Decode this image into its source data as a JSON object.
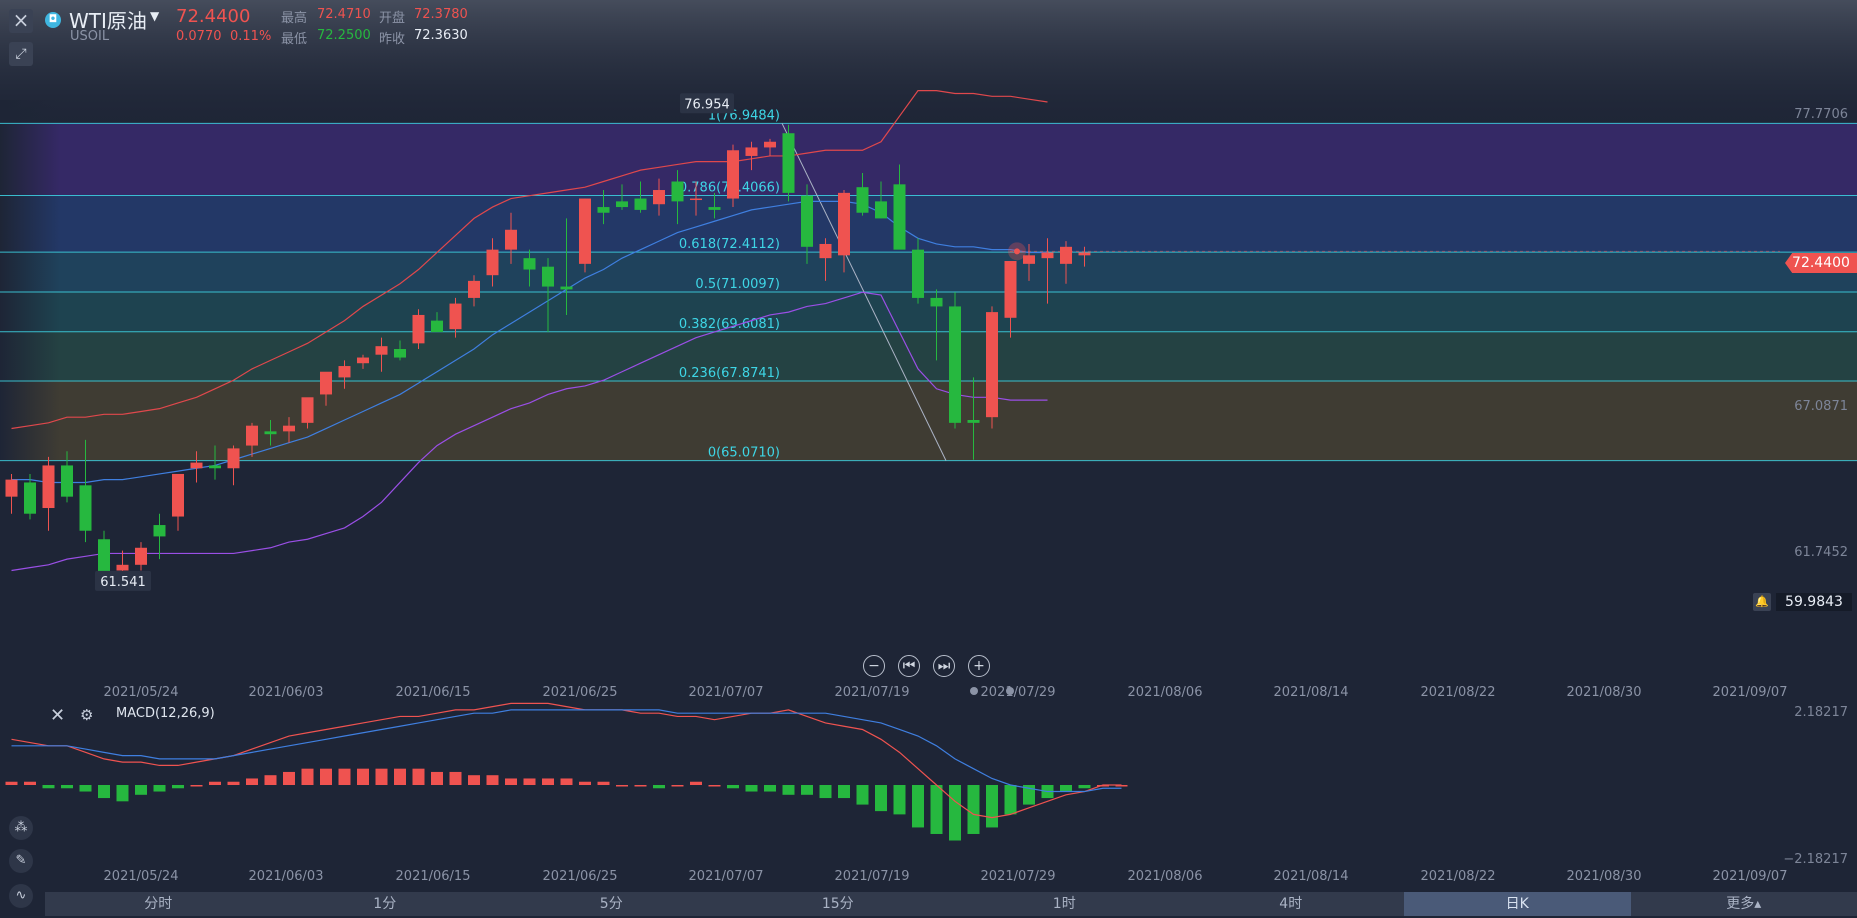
{
  "header": {
    "symbol_name": "WTI原油",
    "symbol_code": "USOIL",
    "price": "72.4400",
    "change": "0.0770",
    "change_pct": "0.11%",
    "high_label": "最高",
    "high": "72.4710",
    "open_label": "开盘",
    "open": "72.3780",
    "low_label": "最低",
    "low": "72.2500",
    "prev_label": "昨收",
    "prev_close": "72.3630"
  },
  "colors": {
    "up": "#ef5350",
    "down": "#26b83f",
    "fib": "#3ed6e6",
    "bb_upper": "#e0484c",
    "bb_mid": "#3f7fe0",
    "bb_lower": "#9a4fe6",
    "background": "#1e2536"
  },
  "price_axis": [
    "77.7706",
    "67.0871",
    "61.7452"
  ],
  "current_price_tag": "72.4400",
  "alert_price": "59.9843",
  "extremes": {
    "high": "76.954",
    "low": "61.541"
  },
  "nav_buttons": [
    "−",
    "⏮",
    "⏭",
    "+"
  ],
  "macd": {
    "title": "MACD(12,26,9)",
    "axis_top": "2.18217",
    "axis_bottom": "−2.18217"
  },
  "tabs": [
    "分时",
    "1分",
    "5分",
    "15分",
    "1时",
    "4时",
    "日K",
    "更多▴"
  ],
  "active_tab": 6,
  "chart_data": {
    "type": "candlestick",
    "dates": [
      "2021/05/24",
      "2021/06/03",
      "2021/06/15",
      "2021/06/25",
      "2021/07/07",
      "2021/07/19",
      "2021/07/29",
      "2021/08/06",
      "2021/08/14",
      "2021/08/22",
      "2021/08/30",
      "2021/09/07"
    ],
    "candles": [
      [
        63.8,
        64.6,
        63.2,
        64.4
      ],
      [
        64.3,
        64.6,
        63.0,
        63.2
      ],
      [
        63.4,
        65.2,
        62.6,
        64.9
      ],
      [
        64.9,
        65.4,
        63.6,
        63.8
      ],
      [
        64.2,
        65.8,
        62.2,
        62.6
      ],
      [
        62.3,
        62.6,
        60.5,
        61.1
      ],
      [
        61.2,
        61.9,
        61.0,
        61.4
      ],
      [
        61.4,
        62.2,
        61.2,
        62.0
      ],
      [
        62.8,
        63.2,
        61.6,
        62.4
      ],
      [
        63.1,
        63.6,
        62.6,
        64.6
      ],
      [
        64.8,
        65.4,
        64.3,
        65.0
      ],
      [
        64.9,
        65.6,
        64.4,
        64.8
      ],
      [
        64.8,
        65.6,
        64.2,
        65.5
      ],
      [
        65.6,
        66.4,
        65.2,
        66.3
      ],
      [
        66.1,
        66.5,
        65.6,
        66.0
      ],
      [
        66.1,
        66.6,
        65.7,
        66.3
      ],
      [
        66.4,
        67.2,
        66.2,
        67.3
      ],
      [
        67.4,
        67.8,
        67.0,
        68.2
      ],
      [
        68.0,
        68.6,
        67.6,
        68.4
      ],
      [
        68.5,
        68.8,
        68.3,
        68.7
      ],
      [
        68.8,
        69.4,
        68.2,
        69.1
      ],
      [
        69.0,
        69.3,
        68.6,
        68.7
      ],
      [
        69.2,
        70.4,
        69.0,
        70.2
      ],
      [
        70.0,
        70.3,
        69.7,
        69.6
      ],
      [
        69.7,
        70.8,
        69.4,
        70.6
      ],
      [
        70.8,
        71.6,
        70.5,
        71.4
      ],
      [
        71.6,
        72.9,
        71.2,
        72.5
      ],
      [
        72.5,
        73.8,
        72.0,
        73.2
      ],
      [
        72.2,
        72.5,
        71.2,
        71.8
      ],
      [
        71.9,
        72.2,
        69.6,
        71.2
      ],
      [
        71.2,
        73.6,
        70.2,
        71.1
      ],
      [
        72.0,
        74.3,
        71.7,
        74.3
      ],
      [
        74.0,
        74.6,
        73.4,
        73.8
      ],
      [
        74.2,
        74.8,
        73.9,
        74.0
      ],
      [
        74.3,
        74.9,
        73.8,
        73.9
      ],
      [
        74.1,
        75.0,
        73.7,
        74.6
      ],
      [
        74.9,
        75.3,
        73.4,
        74.2
      ],
      [
        74.3,
        74.9,
        73.7,
        74.3
      ],
      [
        74.0,
        74.5,
        73.6,
        73.9
      ],
      [
        74.3,
        76.2,
        74.0,
        76.0
      ],
      [
        75.8,
        76.3,
        75.3,
        76.1
      ],
      [
        76.1,
        76.4,
        75.8,
        76.3
      ],
      [
        76.6,
        76.9,
        74.2,
        74.5
      ],
      [
        74.4,
        74.8,
        72.0,
        72.6
      ],
      [
        72.2,
        72.9,
        71.4,
        72.7
      ],
      [
        72.3,
        74.6,
        71.7,
        74.5
      ],
      [
        74.7,
        75.2,
        73.7,
        73.8
      ],
      [
        74.2,
        74.9,
        73.6,
        73.6
      ],
      [
        74.8,
        75.5,
        72.7,
        72.5
      ],
      [
        72.5,
        72.9,
        70.6,
        70.8
      ],
      [
        70.8,
        71.1,
        68.6,
        70.5
      ],
      [
        70.5,
        71.0,
        66.2,
        66.4
      ],
      [
        66.5,
        68.0,
        65.1,
        66.4
      ],
      [
        66.6,
        70.5,
        66.2,
        70.3
      ],
      [
        70.1,
        72.0,
        69.4,
        72.1
      ],
      [
        72.0,
        72.7,
        71.4,
        72.3
      ],
      [
        72.2,
        72.9,
        70.6,
        72.4
      ],
      [
        72.0,
        72.8,
        71.3,
        72.6
      ],
      [
        72.3,
        72.6,
        71.9,
        72.4
      ]
    ],
    "fib": {
      "labels": [
        "1(76.9484)",
        "0.786(74.4066)",
        "0.618(72.4112)",
        "0.5(71.0097)",
        "0.382(69.6081)",
        "0.236(67.8741)",
        "0(65.0710)"
      ],
      "levels": [
        76.9484,
        74.4066,
        72.4112,
        71.0097,
        69.6081,
        67.8741,
        65.071
      ]
    },
    "bollinger": {
      "upper": [
        66.2,
        66.3,
        66.4,
        66.6,
        66.6,
        66.7,
        66.7,
        66.8,
        66.9,
        67.1,
        67.3,
        67.6,
        67.9,
        68.3,
        68.6,
        68.9,
        69.2,
        69.6,
        70.0,
        70.5,
        70.9,
        71.3,
        71.8,
        72.4,
        73.0,
        73.6,
        74.0,
        74.3,
        74.4,
        74.5,
        74.6,
        74.7,
        74.9,
        75.1,
        75.3,
        75.4,
        75.5,
        75.6,
        75.6,
        75.6,
        75.7,
        75.8,
        75.8,
        75.9,
        76.0,
        76.0,
        76.0,
        76.3,
        77.2,
        78.1,
        78.1,
        78.0,
        78.0,
        77.9,
        77.9,
        77.8,
        77.7
      ],
      "mid": [
        64.4,
        64.4,
        64.3,
        64.3,
        64.3,
        64.4,
        64.4,
        64.5,
        64.6,
        64.7,
        64.8,
        64.9,
        65.1,
        65.3,
        65.5,
        65.7,
        65.9,
        66.2,
        66.5,
        66.8,
        67.1,
        67.4,
        67.8,
        68.2,
        68.6,
        69.0,
        69.5,
        69.9,
        70.3,
        70.7,
        71.1,
        71.5,
        71.8,
        72.2,
        72.5,
        72.8,
        73.1,
        73.3,
        73.5,
        73.7,
        73.9,
        74.0,
        74.1,
        74.2,
        74.2,
        74.2,
        74.1,
        73.8,
        73.3,
        72.9,
        72.7,
        72.6,
        72.6,
        72.5,
        72.5,
        72.4,
        72.4
      ],
      "lower": [
        61.2,
        61.3,
        61.4,
        61.6,
        61.7,
        61.8,
        61.8,
        61.8,
        61.8,
        61.8,
        61.8,
        61.8,
        61.8,
        61.9,
        62.0,
        62.2,
        62.3,
        62.5,
        62.7,
        63.1,
        63.6,
        64.3,
        65.0,
        65.6,
        66.0,
        66.3,
        66.6,
        66.9,
        67.1,
        67.4,
        67.6,
        67.7,
        67.9,
        68.2,
        68.5,
        68.8,
        69.1,
        69.4,
        69.6,
        69.8,
        70.0,
        70.2,
        70.3,
        70.5,
        70.6,
        70.8,
        71.0,
        70.9,
        69.6,
        68.3,
        67.6,
        67.4,
        67.3,
        67.3,
        67.2,
        67.2,
        67.2
      ]
    },
    "macd": {
      "dif": [
        1.4,
        1.3,
        1.2,
        1.2,
        1.0,
        0.8,
        0.7,
        0.7,
        0.6,
        0.6,
        0.7,
        0.8,
        0.9,
        1.1,
        1.3,
        1.5,
        1.6,
        1.7,
        1.8,
        1.9,
        2.0,
        2.1,
        2.1,
        2.2,
        2.3,
        2.3,
        2.4,
        2.5,
        2.5,
        2.5,
        2.4,
        2.3,
        2.3,
        2.3,
        2.2,
        2.2,
        2.1,
        2.1,
        2.0,
        2.1,
        2.2,
        2.2,
        2.3,
        2.1,
        1.9,
        1.8,
        1.7,
        1.4,
        1.0,
        0.5,
        0.0,
        -0.5,
        -0.9,
        -1.0,
        -0.9,
        -0.7,
        -0.5,
        -0.3,
        -0.2,
        0.0,
        0.0
      ],
      "dea": [
        1.2,
        1.2,
        1.2,
        1.2,
        1.1,
        1.0,
        0.9,
        0.9,
        0.8,
        0.8,
        0.8,
        0.8,
        0.9,
        1.0,
        1.1,
        1.2,
        1.3,
        1.4,
        1.5,
        1.6,
        1.7,
        1.8,
        1.9,
        2.0,
        2.1,
        2.2,
        2.2,
        2.3,
        2.3,
        2.3,
        2.3,
        2.3,
        2.3,
        2.3,
        2.3,
        2.3,
        2.2,
        2.2,
        2.2,
        2.2,
        2.2,
        2.2,
        2.2,
        2.2,
        2.2,
        2.1,
        2.0,
        1.9,
        1.7,
        1.5,
        1.2,
        0.8,
        0.5,
        0.2,
        0.0,
        -0.1,
        -0.2,
        -0.2,
        -0.2,
        -0.1,
        -0.1
      ],
      "hist": [
        0.1,
        0.1,
        -0.1,
        -0.1,
        -0.2,
        -0.4,
        -0.5,
        -0.3,
        -0.2,
        -0.1,
        0.0,
        0.1,
        0.1,
        0.2,
        0.3,
        0.4,
        0.5,
        0.5,
        0.5,
        0.5,
        0.5,
        0.5,
        0.5,
        0.4,
        0.4,
        0.3,
        0.3,
        0.2,
        0.2,
        0.2,
        0.2,
        0.1,
        0.1,
        0.0,
        0.0,
        -0.1,
        0.0,
        0.1,
        0.0,
        -0.1,
        -0.2,
        -0.2,
        -0.3,
        -0.3,
        -0.4,
        -0.4,
        -0.6,
        -0.8,
        -0.9,
        -1.3,
        -1.5,
        -1.7,
        -1.5,
        -1.3,
        -0.9,
        -0.6,
        -0.4,
        -0.2,
        -0.1,
        0.0,
        0.0
      ],
      "ylim": [
        -2.18217,
        2.18217
      ]
    },
    "ylim": [
      59.9843,
      77.7706
    ],
    "grid": false
  }
}
